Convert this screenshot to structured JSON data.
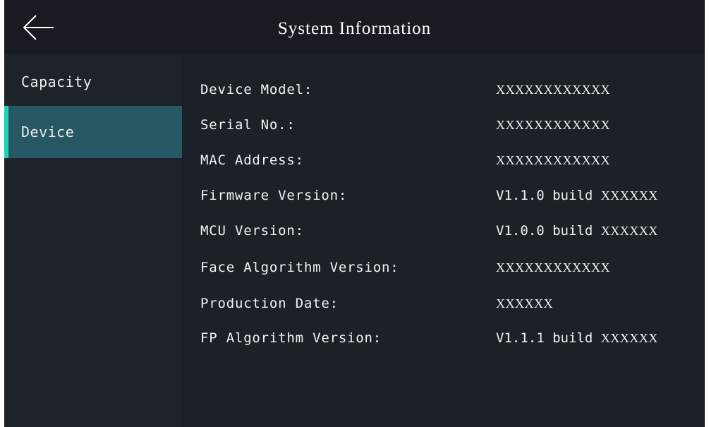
{
  "header": {
    "title": "System Information",
    "back_icon": "arrow-left-icon"
  },
  "sidebar": {
    "items": [
      {
        "label": "Capacity",
        "selected": false
      },
      {
        "label": "Device",
        "selected": true
      }
    ],
    "accent_color": "#1ed1bf",
    "selected_bg": "#265762"
  },
  "device_info": [
    {
      "label": "Device Model:",
      "value": "XXXXXXXXXXXX"
    },
    {
      "label": "Serial No.:",
      "value": "XXXXXXXXXXXX"
    },
    {
      "label": "MAC Address:",
      "value": "XXXXXXXXXXXX"
    },
    {
      "label": "Firmware Version:",
      "value_prefix": "V1.1.0 build",
      "value": "XXXXXX"
    },
    {
      "label": "MCU Version:",
      "value_prefix": "V1.0.0 build",
      "value": "XXXXXX"
    },
    {
      "label": "Face Algorithm Version:",
      "value": "XXXXXXXXXXXX"
    },
    {
      "label": "Production Date:",
      "value": "XXXXXX"
    },
    {
      "label": "FP Algorithm Version:",
      "value_prefix": "V1.1.1 build",
      "value": "XXXXXX"
    }
  ]
}
